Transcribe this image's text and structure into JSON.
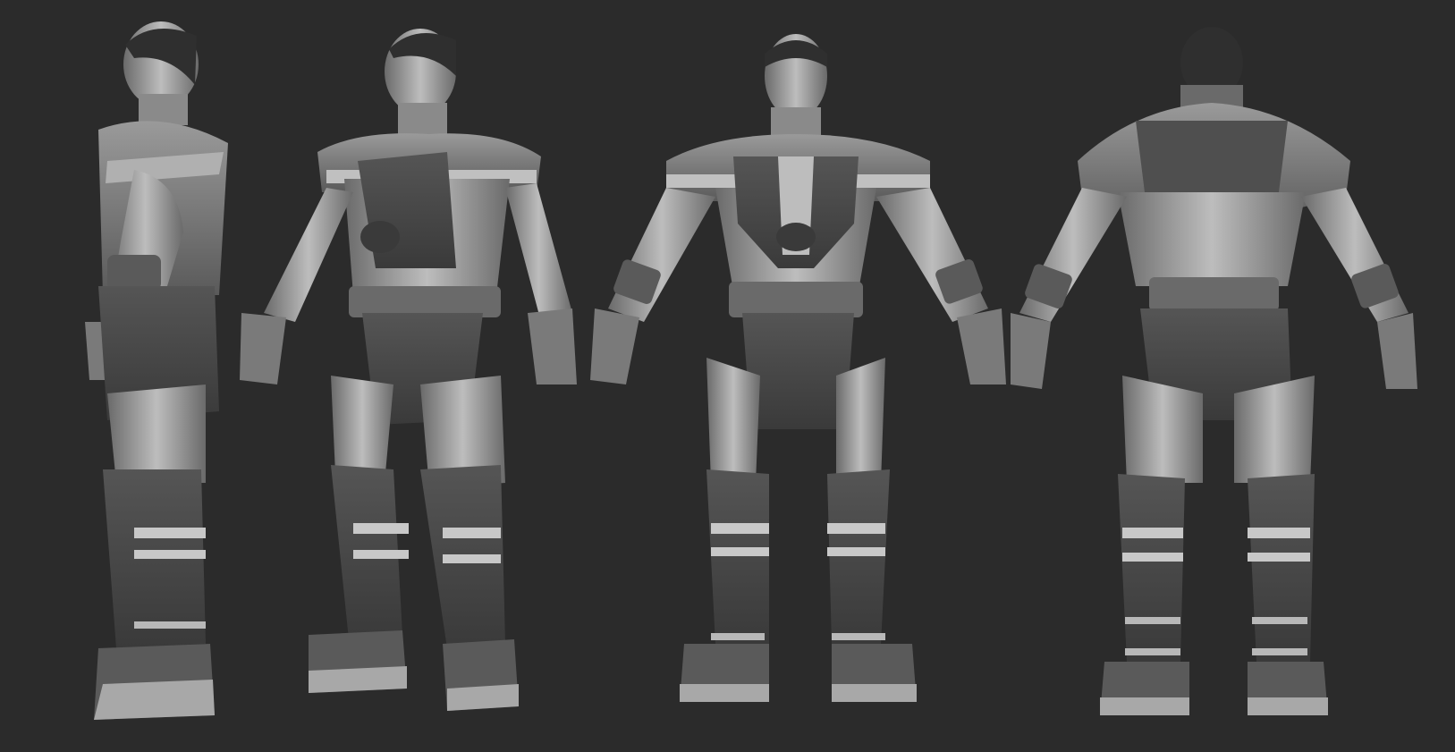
{
  "scene": {
    "background_color": "#2b2b2b",
    "views": [
      {
        "name": "side"
      },
      {
        "name": "three-quarter"
      },
      {
        "name": "front"
      },
      {
        "name": "back"
      }
    ]
  },
  "colors": {
    "clay_light": "#bdbdbd",
    "clay_mid": "#8a8a8a",
    "clay_dark": "#4a4a4a",
    "clay_shadow": "#363636",
    "trim_light": "#d6d6d6"
  }
}
